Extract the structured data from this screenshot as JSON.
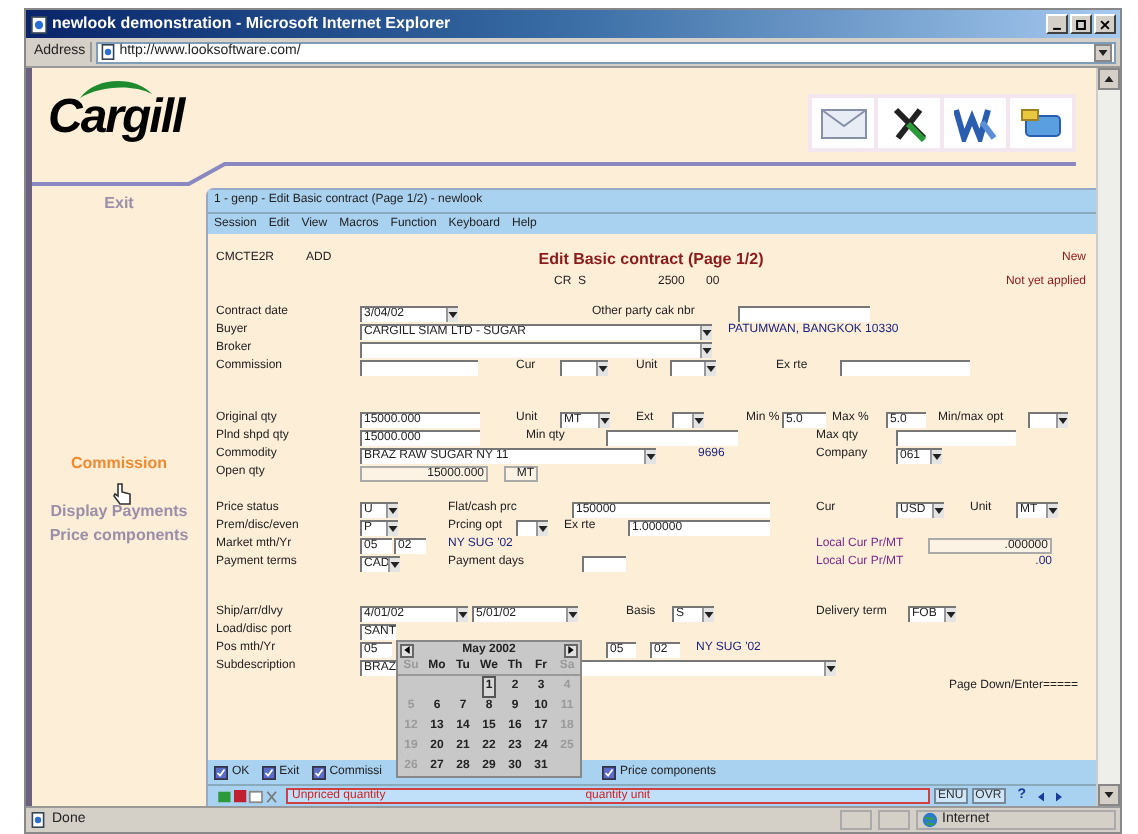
{
  "browser": {
    "title": "newlook demonstration - Microsoft Internet Explorer",
    "address_label": "Address",
    "url": "http://www.looksoftware.com/"
  },
  "header": {
    "logo": "Cargill"
  },
  "sidebar": {
    "items": [
      {
        "label": "Exit",
        "selected": false
      },
      {
        "label": "Commission",
        "selected": true
      },
      {
        "label": "Display Payments",
        "selected": false
      },
      {
        "label": "Price components",
        "selected": false
      }
    ]
  },
  "session": {
    "title": "1 - genp - Edit Basic contract (Page 1/2) - newlook",
    "menu": [
      "Session",
      "Edit",
      "View",
      "Macros",
      "Function",
      "Keyboard",
      "Help"
    ],
    "screen_id": "CMCTE2R",
    "mode": "ADD",
    "heading": "Edit Basic contract (Page 1/2)",
    "status": "New",
    "applied": "Not yet applied",
    "key": [
      "CR",
      "S",
      "2500",
      "00"
    ],
    "sections": [
      [
        [
          {
            "kind": "label",
            "text": "Contract date"
          },
          {
            "kind": "select",
            "value": "3/04/02"
          },
          {
            "kind": "label",
            "text": "Other party cak nbr"
          },
          {
            "kind": "field"
          }
        ],
        [
          {
            "kind": "label",
            "text": "Buyer"
          },
          {
            "kind": "select",
            "value": "CARGILL SIAM LTD - SUGAR"
          },
          {
            "kind": "text",
            "text": "PATUMWAN, BANGKOK 10330"
          }
        ],
        [
          {
            "kind": "label",
            "text": "Broker"
          },
          {
            "kind": "select"
          }
        ],
        [
          {
            "kind": "label",
            "text": "Commission"
          },
          {
            "kind": "field"
          },
          {
            "kind": "label",
            "text": "Cur"
          },
          {
            "kind": "select"
          },
          {
            "kind": "label",
            "text": "Unit"
          },
          {
            "kind": "select"
          },
          {
            "kind": "label",
            "text": "Ex rte"
          },
          {
            "kind": "field"
          }
        ]
      ],
      [
        [
          {
            "kind": "label",
            "text": "Original qty"
          },
          {
            "kind": "field",
            "value": "15000.000"
          },
          {
            "kind": "label",
            "text": "Unit"
          },
          {
            "kind": "select",
            "value": "MT"
          },
          {
            "kind": "label",
            "text": "Ext"
          },
          {
            "kind": "select"
          },
          {
            "kind": "label",
            "text": "Min %"
          },
          {
            "kind": "field",
            "value": "5.0"
          },
          {
            "kind": "label",
            "text": "Max %"
          },
          {
            "kind": "field",
            "value": "5.0"
          },
          {
            "kind": "label",
            "text": "Min/max opt"
          },
          {
            "kind": "select"
          }
        ],
        [
          {
            "kind": "label",
            "text": "Plnd shpd qty"
          },
          {
            "kind": "field",
            "value": "15000.000"
          },
          {
            "kind": "label",
            "text": "Min qty"
          },
          {
            "kind": "field"
          },
          {
            "kind": "label",
            "text": "Max qty"
          },
          {
            "kind": "field"
          }
        ],
        [
          {
            "kind": "label",
            "text": "Commodity"
          },
          {
            "kind": "select",
            "value": "BRAZ RAW SUGAR NY 11"
          },
          {
            "kind": "text",
            "text": "9696"
          },
          {
            "kind": "label",
            "text": "Company"
          },
          {
            "kind": "select",
            "value": "061"
          }
        ],
        [
          {
            "kind": "label",
            "text": "Open qty"
          },
          {
            "kind": "readonly",
            "value": "15000.000"
          },
          {
            "kind": "readonly",
            "value": "MT"
          }
        ]
      ],
      [
        [
          {
            "kind": "label",
            "text": "Price status"
          },
          {
            "kind": "select",
            "value": "U"
          },
          {
            "kind": "label",
            "text": "Flat/cash prc"
          },
          {
            "kind": "field",
            "value": "150000"
          },
          {
            "kind": "label",
            "text": "Cur"
          },
          {
            "kind": "select",
            "value": "USD"
          },
          {
            "kind": "label",
            "text": "Unit"
          },
          {
            "kind": "select",
            "value": "MT"
          }
        ],
        [
          {
            "kind": "label",
            "text": "Prem/disc/even"
          },
          {
            "kind": "select",
            "value": "P"
          },
          {
            "kind": "label",
            "text": "Prcing opt"
          },
          {
            "kind": "select"
          },
          {
            "kind": "label",
            "text": "Ex rte"
          },
          {
            "kind": "field",
            "value": "1.000000"
          }
        ],
        [
          {
            "kind": "label",
            "text": "Market mth/Yr"
          },
          {
            "kind": "field",
            "value": "05"
          },
          {
            "kind": "field",
            "value": "02"
          },
          {
            "kind": "text",
            "text": "NY SUG '02"
          },
          {
            "kind": "note",
            "text": "Local Cur Pr/MT"
          },
          {
            "kind": "readonly",
            "value": ".000000"
          }
        ],
        [
          {
            "kind": "label",
            "text": "Payment terms"
          },
          {
            "kind": "select",
            "value": "CAD"
          },
          {
            "kind": "label",
            "text": "Payment days"
          },
          {
            "kind": "field"
          },
          {
            "kind": "note",
            "text": "Local Cur Pr/MT"
          },
          {
            "kind": "text",
            "text": ".00"
          }
        ]
      ],
      [
        [
          {
            "kind": "label",
            "text": "Ship/arr/dlvy"
          },
          {
            "kind": "select",
            "value": "4/01/02"
          },
          {
            "kind": "select",
            "value": "5/01/02"
          },
          {
            "kind": "label",
            "text": "Basis"
          },
          {
            "kind": "select",
            "value": "S"
          },
          {
            "kind": "label",
            "text": "Delivery term"
          },
          {
            "kind": "select",
            "value": "FOB"
          }
        ],
        [
          {
            "kind": "label",
            "text": "Load/disc port"
          },
          {
            "kind": "field",
            "value": "SANT"
          }
        ],
        [
          {
            "kind": "label",
            "text": "Pos mth/Yr"
          },
          {
            "kind": "field",
            "value": "05"
          },
          {
            "kind": "field",
            "value": "05"
          },
          {
            "kind": "field",
            "value": "02"
          },
          {
            "kind": "text",
            "text": "NY SUG '02"
          }
        ],
        [
          {
            "kind": "label",
            "text": "Subdescription"
          },
          {
            "kind": "select",
            "value": "BRAZ"
          }
        ]
      ]
    ],
    "page_hint": "Page Down/Enter=====",
    "buttons": [
      {
        "label": "OK"
      },
      {
        "label": "Exit"
      },
      {
        "label": "Commissi"
      },
      {
        "label": "Price components"
      }
    ],
    "message_left": "Unpriced quantity",
    "message_right": "quantity unit",
    "indicators": [
      "ENU",
      "OVR"
    ],
    "help": "?"
  },
  "calendar": {
    "month": "May 2002",
    "weekdays": [
      "Su",
      "Mo",
      "Tu",
      "We",
      "Th",
      "Fr",
      "Sa"
    ],
    "weeks": [
      [
        {
          "day": "1",
          "selected": true
        },
        {
          "day": "2",
          "selected": false
        },
        {
          "day": "3",
          "selected": false
        },
        {
          "day": "4",
          "selected": false
        }
      ],
      [
        {
          "day": "5",
          "selected": false
        },
        {
          "day": "6",
          "selected": false
        },
        {
          "day": "7",
          "selected": false
        },
        {
          "day": "8",
          "selected": false
        },
        {
          "day": "9",
          "selected": false
        },
        {
          "day": "10",
          "selected": false
        },
        {
          "day": "11",
          "selected": false
        }
      ],
      [
        {
          "day": "12",
          "selected": false
        },
        {
          "day": "13",
          "selected": false
        },
        {
          "day": "14",
          "selected": false
        },
        {
          "day": "15",
          "selected": false
        },
        {
          "day": "16",
          "selected": false
        },
        {
          "day": "17",
          "selected": false
        },
        {
          "day": "18",
          "selected": false
        }
      ],
      [
        {
          "day": "19",
          "selected": false
        },
        {
          "day": "20",
          "selected": false
        },
        {
          "day": "21",
          "selected": false
        },
        {
          "day": "22",
          "selected": false
        },
        {
          "day": "23",
          "selected": false
        },
        {
          "day": "24",
          "selected": false
        },
        {
          "day": "25",
          "selected": false
        }
      ],
      [
        {
          "day": "26",
          "selected": false
        },
        {
          "day": "27",
          "selected": false
        },
        {
          "day": "28",
          "selected": false
        },
        {
          "day": "29",
          "selected": false
        },
        {
          "day": "30",
          "selected": false
        },
        {
          "day": "31",
          "selected": false
        }
      ]
    ]
  },
  "status_bar": {
    "text": "Done",
    "zone": "Internet"
  }
}
